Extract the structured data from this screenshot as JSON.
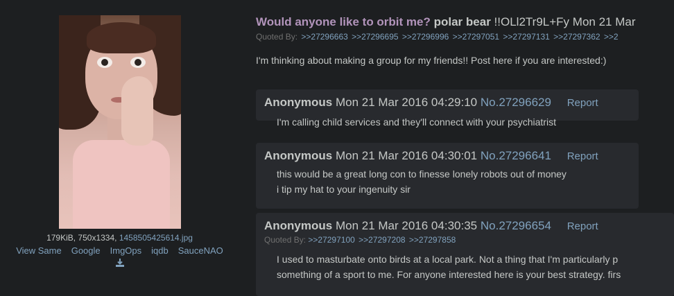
{
  "op": {
    "subject": "Would anyone like to orbit me?",
    "name": "polar bear",
    "tripcode": "!!OLl2Tr9L+Fy",
    "date": "Mon 21 Mar",
    "quoted_by_label": "Quoted By:",
    "quoted_by": [
      ">>27296663",
      ">>27296695",
      ">>27296996",
      ">>27297051",
      ">>27297131",
      ">>27297362",
      ">>2"
    ],
    "text": "I'm thinking about making a group for my friends!! Post here if you are interested:)",
    "file": {
      "meta": "179KiB, 750x1334,",
      "filename": "1458505425614.jpg"
    },
    "image_tools": [
      "View Same",
      "Google",
      "ImgOps",
      "iqdb",
      "SauceNAO"
    ]
  },
  "replies": [
    {
      "name": "Anonymous",
      "date": "Mon 21 Mar 2016 04:29:10",
      "number": "No.27296629",
      "report": "Report",
      "lines": [
        "I'm calling child services and they'll connect with your psychiatrist"
      ]
    },
    {
      "name": "Anonymous",
      "date": "Mon 21 Mar 2016 04:30:01",
      "number": "No.27296641",
      "report": "Report",
      "lines": [
        "this would be a great long con to finesse lonely robots out of money",
        "i tip my hat to your ingenuity sir"
      ]
    },
    {
      "name": "Anonymous",
      "date": "Mon 21 Mar 2016 04:30:35",
      "number": "No.27296654",
      "report": "Report",
      "quoted_by_label": "Quoted By:",
      "quoted_by": [
        ">>27297100",
        ">>27297208",
        ">>27297858"
      ],
      "lines": [
        "I used to masturbate onto birds at a local park. Not a thing that I'm particularly p",
        "something of a sport to me. For anyone interested here is your best strategy. firs"
      ]
    }
  ],
  "colors": {
    "background": "#1d1f21",
    "reply_bg": "#282a2e",
    "link": "#81a2be",
    "subject": "#b294bb",
    "text": "#c5c8c6"
  }
}
